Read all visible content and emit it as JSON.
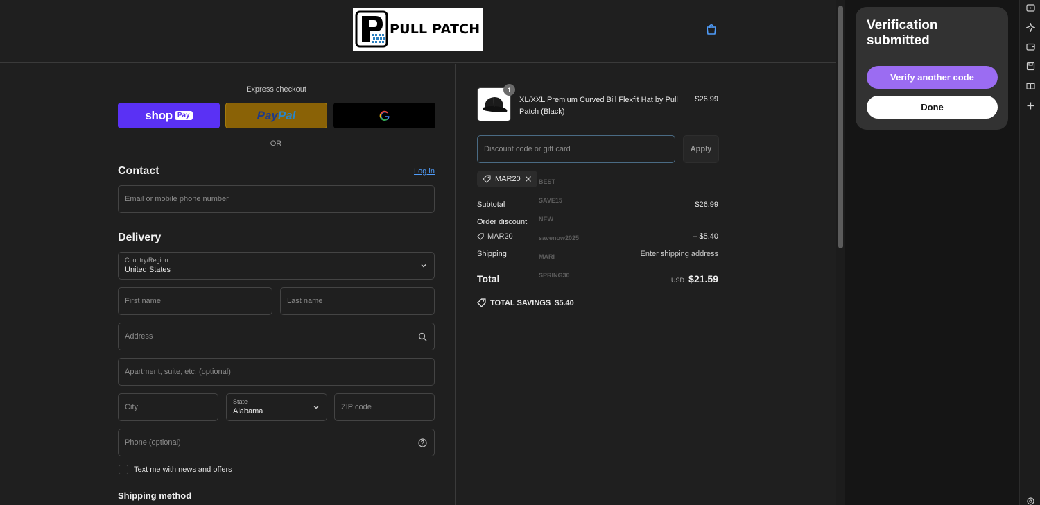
{
  "header": {
    "brand": "PULL PATCH"
  },
  "express": {
    "title": "Express checkout",
    "shop_label": "shop",
    "shop_pay_badge": "Pay",
    "paypal_label_a": "Pay",
    "paypal_label_b": "Pal",
    "or_text": "OR"
  },
  "contact": {
    "title": "Contact",
    "login_link": "Log in",
    "email_placeholder": "Email or mobile phone number"
  },
  "delivery": {
    "title": "Delivery",
    "country_label": "Country/Region",
    "country_value": "United States",
    "first_name_placeholder": "First name",
    "last_name_placeholder": "Last name",
    "address_placeholder": "Address",
    "apartment_placeholder": "Apartment, suite, etc. (optional)",
    "city_placeholder": "City",
    "state_label": "State",
    "state_value": "Alabama",
    "zip_placeholder": "ZIP code",
    "phone_placeholder": "Phone (optional)",
    "newsletter_label": "Text me with news and offers"
  },
  "shipping_method": {
    "title": "Shipping method"
  },
  "order": {
    "product_name": "XL/XXL Premium Curved Bill Flexfit Hat by Pull Patch (Black)",
    "product_price": "$26.99",
    "quantity": "1",
    "discount_placeholder": "Discount code or gift card",
    "apply_label": "Apply",
    "applied_code": "MAR20",
    "ghost_codes": [
      "BEST",
      "SAVE15",
      "NEW",
      "savenow2025",
      "MARI",
      "SPRING30"
    ],
    "subtotal_label": "Subtotal",
    "subtotal_value": "$26.99",
    "order_discount_label": "Order discount",
    "discount_code": "MAR20",
    "discount_value": "– $5.40",
    "shipping_label": "Shipping",
    "shipping_value": "Enter shipping address",
    "total_label": "Total",
    "total_currency": "USD",
    "total_value": "$21.59",
    "savings_label": "TOTAL SAVINGS",
    "savings_value": "$5.40"
  },
  "side_panel": {
    "title": "Verification submitted",
    "verify_another_label": "Verify another code",
    "done_label": "Done"
  },
  "toolbar": {
    "icons": [
      "media-icon",
      "sparkle-icon",
      "wallet-icon",
      "save-icon",
      "reader-icon",
      "plus-icon"
    ]
  },
  "colors": {
    "page_bg": "#1f1f1f",
    "shop_pay": "#5a31f4",
    "paypal": "#8a6206",
    "link": "#4f9cf9",
    "verify_button": "#9b6cf2"
  }
}
